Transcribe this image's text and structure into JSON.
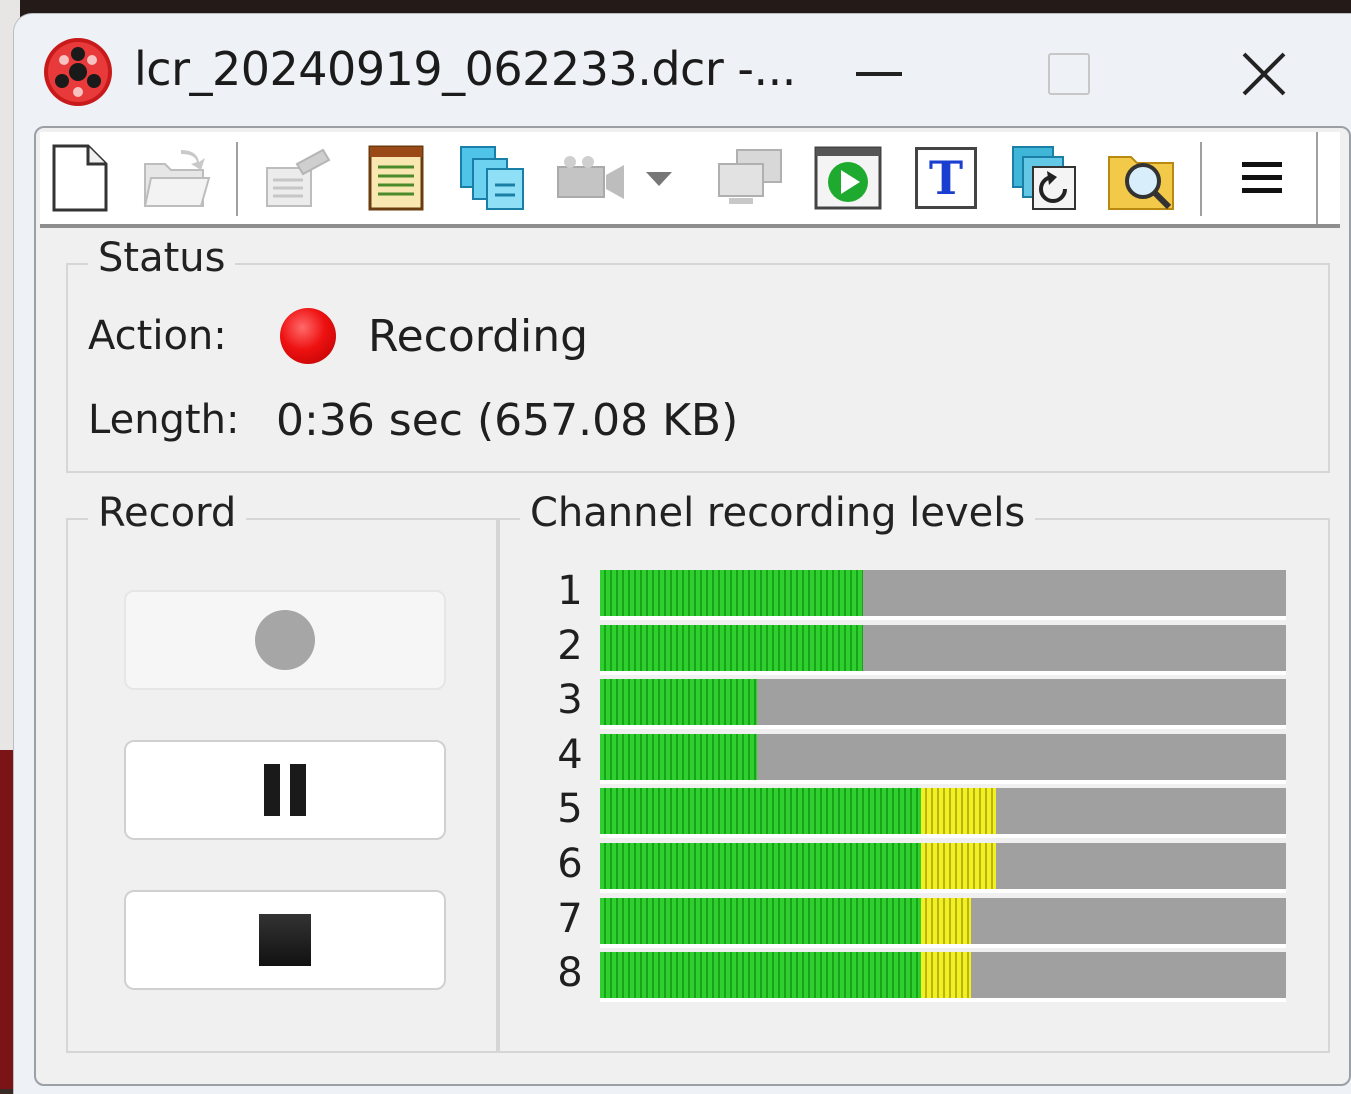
{
  "window": {
    "title": "lcr_20240919_062233.dcr -...",
    "icon": "recorder-app-icon"
  },
  "toolbar": {
    "buttons": [
      {
        "icon": "new-file-icon",
        "enabled": true
      },
      {
        "icon": "open-folder-icon",
        "enabled": false
      },
      {
        "icon": "properties-icon",
        "enabled": false
      },
      {
        "icon": "notes-icon",
        "enabled": true
      },
      {
        "icon": "copy-files-icon",
        "enabled": true
      },
      {
        "icon": "video-camera-icon",
        "enabled": false
      },
      {
        "icon": "network-icon",
        "enabled": false
      },
      {
        "icon": "play-icon",
        "enabled": true
      },
      {
        "icon": "text-icon",
        "enabled": true
      },
      {
        "icon": "revert-icon",
        "enabled": true
      },
      {
        "icon": "search-folder-icon",
        "enabled": true
      },
      {
        "icon": "menu-icon",
        "enabled": true
      }
    ],
    "text_button_glyph": "T"
  },
  "status": {
    "title": "Status",
    "action_label": "Action:",
    "action_value": "Recording",
    "length_label": "Length:",
    "length_value": "0:36 sec (657.08 KB)"
  },
  "record": {
    "title": "Record",
    "buttons": [
      {
        "name": "record-button",
        "icon": "record-icon",
        "enabled": false
      },
      {
        "name": "pause-button",
        "icon": "pause-icon",
        "enabled": true
      },
      {
        "name": "stop-button",
        "icon": "stop-icon",
        "enabled": true
      }
    ]
  },
  "levels": {
    "title": "Channel recording levels",
    "channels": [
      {
        "label": "1",
        "green": 0.385,
        "yellow": 0
      },
      {
        "label": "2",
        "green": 0.385,
        "yellow": 0
      },
      {
        "label": "3",
        "green": 0.23,
        "yellow": 0
      },
      {
        "label": "4",
        "green": 0.23,
        "yellow": 0
      },
      {
        "label": "5",
        "green": 0.47,
        "yellow": 0.11
      },
      {
        "label": "6",
        "green": 0.47,
        "yellow": 0.11
      },
      {
        "label": "7",
        "green": 0.47,
        "yellow": 0.073
      },
      {
        "label": "8",
        "green": 0.47,
        "yellow": 0.073
      }
    ],
    "colors": {
      "green": "#2fcf2f",
      "yellow": "#f2f020",
      "track": "#a0a0a0"
    }
  },
  "colors": {
    "recording_dot": "#ee1111"
  }
}
